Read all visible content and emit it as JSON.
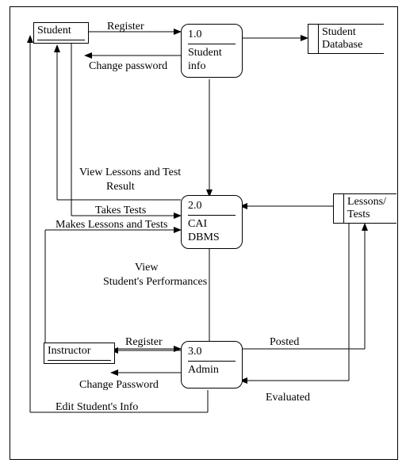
{
  "chart_data": {
    "type": "diagram",
    "title": "",
    "entities": [
      {
        "id": "student",
        "label": "Student"
      },
      {
        "id": "instructor",
        "label": "Instructor"
      }
    ],
    "processes": [
      {
        "id": "p1",
        "number": "1.0",
        "label": "Student info"
      },
      {
        "id": "p2",
        "number": "2.0",
        "label": "CAI DBMS"
      },
      {
        "id": "p3",
        "number": "3.0",
        "label": "Admin"
      }
    ],
    "datastores": [
      {
        "id": "ds1",
        "label": "Student Database"
      },
      {
        "id": "ds2",
        "label": "Lessons/ Tests"
      }
    ],
    "flows": [
      {
        "from": "student",
        "to": "p1",
        "label": "Register"
      },
      {
        "from": "p1",
        "to": "student",
        "label": "Change password"
      },
      {
        "from": "p1",
        "to": "ds1",
        "label": ""
      },
      {
        "from": "p1",
        "to": "p2",
        "label": ""
      },
      {
        "from": "p2",
        "to": "student",
        "label": "View Lessons and Test Result"
      },
      {
        "from": "student",
        "to": "p2",
        "label": "Takes Tests"
      },
      {
        "from": "instructor",
        "to": "p2",
        "label": "Makes Lessons and Tests"
      },
      {
        "from": "p2",
        "to": "instructor",
        "label": "View Student's Performances"
      },
      {
        "from": "ds2",
        "to": "p2",
        "label": ""
      },
      {
        "from": "instructor",
        "to": "p3",
        "label": "Register"
      },
      {
        "from": "p3",
        "to": "instructor",
        "label": "Change Password"
      },
      {
        "from": "p3",
        "to": "student",
        "label": "Edit Student's Info"
      },
      {
        "from": "p3",
        "to": "ds2",
        "label": "Posted"
      },
      {
        "from": "ds2",
        "to": "p3",
        "label": "Evaluated"
      }
    ]
  },
  "entities": {
    "student": "Student",
    "instructor": "Instructor"
  },
  "processes": {
    "p1": {
      "num": "1.0",
      "name1": "Student",
      "name2": "info"
    },
    "p2": {
      "num": "2.0",
      "name1": "CAI",
      "name2": "DBMS"
    },
    "p3": {
      "num": "3.0",
      "name1": "Admin",
      "name2": ""
    }
  },
  "datastores": {
    "ds1a": "Student",
    "ds1b": "Database",
    "ds2a": "Lessons/",
    "ds2b": "Tests"
  },
  "labels": {
    "register1": "Register",
    "change_pw1": "Change password",
    "view_lessons1": "View Lessons and Test",
    "view_lessons2": "Result",
    "takes_tests": "Takes Tests",
    "makes_lessons": "Makes Lessons and Tests",
    "view_perf1": "View",
    "view_perf2": "Student's Performances",
    "register2": "Register",
    "posted": "Posted",
    "change_pw2": "Change Password",
    "evaluated": "Evaluated",
    "edit_student": "Edit Student's Info"
  }
}
